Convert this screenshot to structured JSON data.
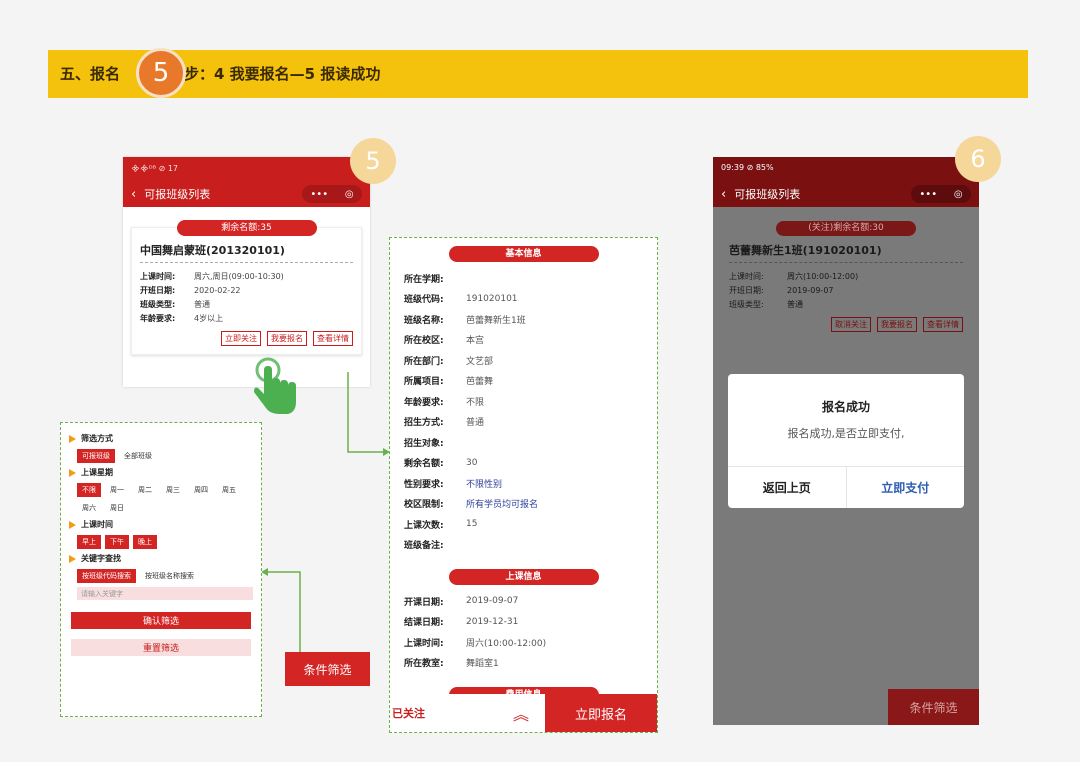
{
  "banner": {
    "prefix": "五、报名",
    "step_number": "5",
    "suffix": "步：4 我要报名—5 报读成功"
  },
  "badges": {
    "phone1": "5",
    "phone2": "6"
  },
  "phone1": {
    "status": "᯽᯽ᴰᴮ ⊘ 17",
    "nav_title": "可报班级列表",
    "back_icon": "chevron-left",
    "capsule_dots": "•••",
    "capsule_target": "◎",
    "card": {
      "remain": "剩余名额:35",
      "title": "中国舞启蒙班(201320101)",
      "rows": [
        {
          "k": "上课时间:",
          "v": "周六,周日(09:00-10:30)"
        },
        {
          "k": "开班日期:",
          "v": "2020-02-22"
        },
        {
          "k": "班级类型:",
          "v": "普通"
        },
        {
          "k": "年龄要求:",
          "v": "4岁以上"
        }
      ],
      "buttons": [
        "立即关注",
        "我要报名",
        "查看详情"
      ]
    },
    "filter_tab": "条件筛选"
  },
  "filter": {
    "sections": [
      {
        "title": "筛选方式",
        "chips": [
          {
            "label": "可报班级",
            "on": true
          },
          {
            "label": "全部班级",
            "on": false
          }
        ]
      },
      {
        "title": "上课星期",
        "chips": [
          {
            "label": "不限",
            "on": true
          },
          {
            "label": "周一",
            "on": false
          },
          {
            "label": "周二",
            "on": false
          },
          {
            "label": "周三",
            "on": false
          },
          {
            "label": "周四",
            "on": false
          },
          {
            "label": "周五",
            "on": false
          },
          {
            "label": "周六",
            "on": false
          },
          {
            "label": "周日",
            "on": false
          }
        ]
      },
      {
        "title": "上课时间",
        "chips": [
          {
            "label": "早上",
            "on": true
          },
          {
            "label": "下午",
            "on": true
          },
          {
            "label": "晚上",
            "on": true
          }
        ]
      },
      {
        "title": "关键字查找",
        "chips": [
          {
            "label": "按班级代码搜索",
            "on": true
          },
          {
            "label": "按班级名称搜索",
            "on": false
          }
        ]
      }
    ],
    "keyword_placeholder": "请输入关键字",
    "confirm": "确认筛选",
    "reset": "重置筛选"
  },
  "detail": {
    "basic_title": "基本信息",
    "basic": [
      {
        "k": "所在学期:",
        "v": ""
      },
      {
        "k": "班级代码:",
        "v": "191020101"
      },
      {
        "k": "班级名称:",
        "v": "芭蕾舞新生1班"
      },
      {
        "k": "所在校区:",
        "v": "本宫"
      },
      {
        "k": "所在部门:",
        "v": "文艺部"
      },
      {
        "k": "所属项目:",
        "v": "芭蕾舞"
      },
      {
        "k": "年龄要求:",
        "v": "不限"
      },
      {
        "k": "招生方式:",
        "v": "普通"
      },
      {
        "k": "招生对象:",
        "v": ""
      },
      {
        "k": "剩余名额:",
        "v": "30"
      },
      {
        "k": "性别要求:",
        "v": "不限性别",
        "blue": true
      },
      {
        "k": "校区限制:",
        "v": "所有学员均可报名",
        "blue": true
      },
      {
        "k": "上课次数:",
        "v": "15"
      },
      {
        "k": "班级备注:",
        "v": ""
      }
    ],
    "class_title": "上课信息",
    "class": [
      {
        "k": "开课日期:",
        "v": "2019-09-07"
      },
      {
        "k": "结课日期:",
        "v": "2019-12-31"
      },
      {
        "k": "上课时间:",
        "v": "周六(10:00-12:00)"
      },
      {
        "k": "所在教室:",
        "v": "舞蹈室1"
      }
    ],
    "fee_title": "费用信息",
    "followed": "已关注",
    "enroll": "立即报名"
  },
  "phone2": {
    "status": "09:39 ⊘ 85%",
    "nav_title": "可报班级列表",
    "card": {
      "remain": "(关注)剩余名额:30",
      "title": "芭蕾舞新生1班(191020101)",
      "rows": [
        {
          "k": "上课时间:",
          "v": "周六(10:00-12:00)"
        },
        {
          "k": "开班日期:",
          "v": "2019-09-07"
        },
        {
          "k": "班级类型:",
          "v": "普通"
        }
      ],
      "buttons": [
        "取消关注",
        "我要报名",
        "查看详情"
      ]
    },
    "dialog": {
      "title": "报名成功",
      "message": "报名成功,是否立即支付,",
      "back": "返回上页",
      "pay": "立即支付"
    },
    "filter_tab": "条件筛选"
  }
}
